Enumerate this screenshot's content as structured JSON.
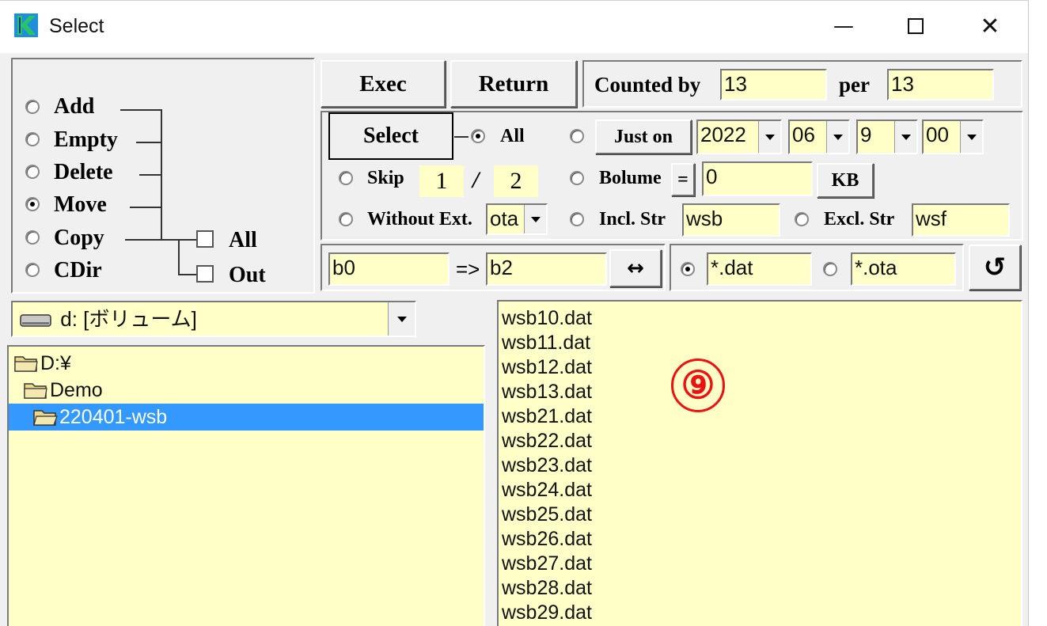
{
  "window": {
    "title": "Select"
  },
  "titlebar": {
    "minimize": "—",
    "close": "✕"
  },
  "mode": {
    "options": [
      "Add",
      "Empty",
      "Delete",
      "Move",
      "Copy",
      "CDir"
    ],
    "selected": "Move",
    "checks": [
      {
        "label": "All",
        "checked": false
      },
      {
        "label": "Out",
        "checked": false
      }
    ]
  },
  "toolbar": {
    "exec_label": "Exec",
    "return_label": "Return",
    "counted_by_label": "Counted by",
    "counted_by_value": "13",
    "per_label": "per",
    "per_value": "13"
  },
  "select": {
    "select_label": "Select",
    "all_label": "All",
    "just_on_label": "Just on",
    "year": "2022",
    "month": "06",
    "day": "9",
    "hour": "00",
    "skip_label": "Skip",
    "skip_num": "1",
    "skip_sep": "/",
    "skip_den": "2",
    "bolume_label": "Bolume",
    "bolume_op": "=",
    "bolume_value": "0",
    "kb_label": "KB",
    "without_ext_label": "Without Ext.",
    "without_ext_value": "ota",
    "incl_label": "Incl. Str",
    "incl_value": "wsb",
    "excl_label": "Excl. Str",
    "excl_value": "wsf"
  },
  "rename": {
    "from": "b0",
    "arrow": "=>",
    "to": "b2",
    "swap_symbol": "↔"
  },
  "filter": {
    "pattern1": "*.dat",
    "pattern2": "*.ota",
    "selected": "pattern1",
    "refresh_symbol": "↺"
  },
  "drive": {
    "value": "d: [ボリューム]"
  },
  "tree": [
    {
      "label": "D:¥",
      "level": 0,
      "selected": false
    },
    {
      "label": "Demo",
      "level": 1,
      "selected": false
    },
    {
      "label": "220401-wsb",
      "level": 2,
      "selected": true
    }
  ],
  "files": [
    "wsb10.dat",
    "wsb11.dat",
    "wsb12.dat",
    "wsb13.dat",
    "wsb21.dat",
    "wsb22.dat",
    "wsb23.dat",
    "wsb24.dat",
    "wsb25.dat",
    "wsb26.dat",
    "wsb27.dat",
    "wsb28.dat",
    "wsb29.dat"
  ],
  "annotation": "⑨",
  "colors": {
    "field_bg": "#ffffc8",
    "selection": "#3399ff",
    "annotation": "#ee1111"
  }
}
